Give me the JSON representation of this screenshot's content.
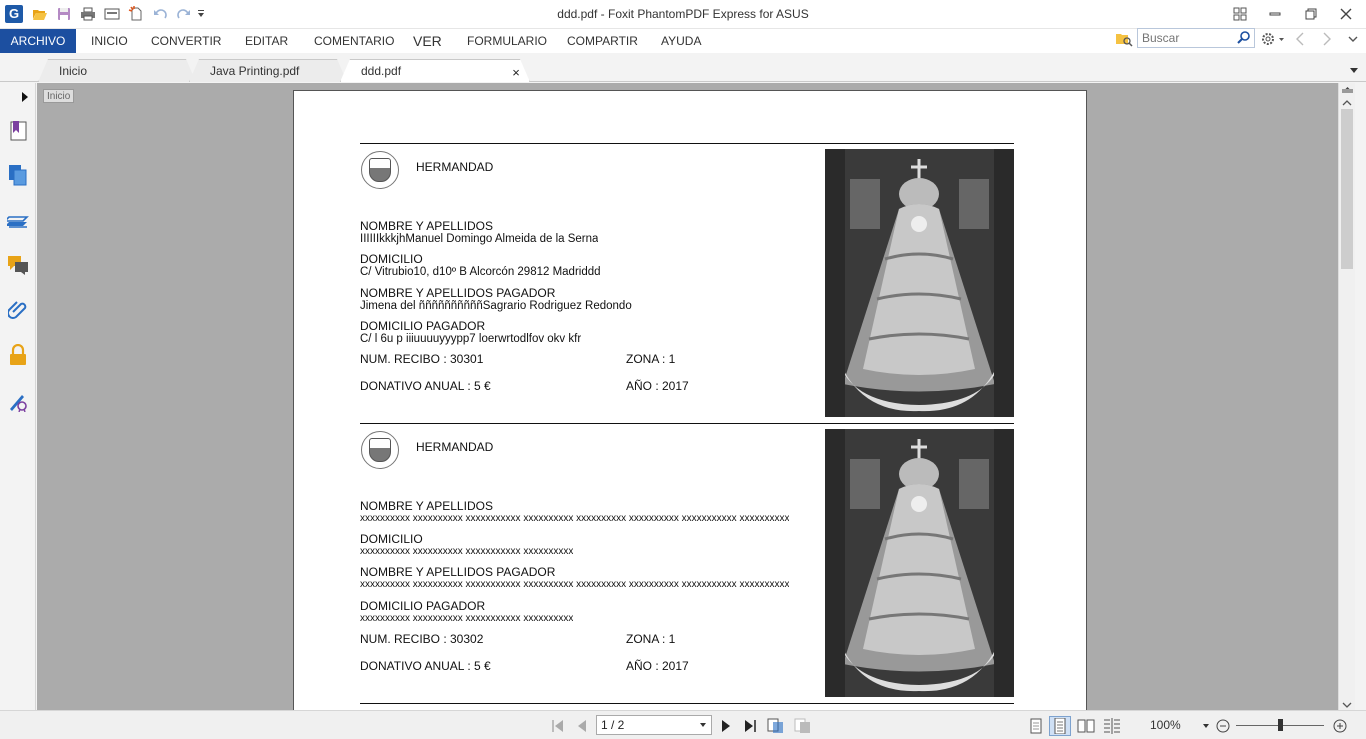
{
  "window": {
    "title": "ddd.pdf - Foxit PhantomPDF Express for ASUS",
    "logo_letter": "G"
  },
  "menu": {
    "items": [
      "ARCHIVO",
      "INICIO",
      "CONVERTIR",
      "EDITAR",
      "COMENTARIO",
      "VER",
      "FORMULARIO",
      "COMPARTIR",
      "AYUDA"
    ],
    "active": "ARCHIVO"
  },
  "search": {
    "placeholder": "Buscar"
  },
  "tabs": [
    {
      "label": "Inicio"
    },
    {
      "label": "Java Printing.pdf"
    },
    {
      "label": "ddd.pdf",
      "active": true
    }
  ],
  "tooltip": "Inicio",
  "receipts": [
    {
      "title": "HERMANDAD",
      "fields": [
        {
          "label": "NOMBRE Y APELLIDOS",
          "value": "IIIIIIkkkjhManuel Domingo Almeida de la Serna"
        },
        {
          "label": "DOMICILIO",
          "value": "C/ Vitrubio10, d10º B Alcorcón 29812 Madriddd"
        },
        {
          "label": "NOMBRE Y APELLIDOS PAGADOR",
          "value": "Jimena del ññññññññññSagrario Rodriguez Redondo"
        },
        {
          "label": "DOMICILIO PAGADOR",
          "value": "C/ l 6u p iiiuuuuyyypp7 loerwrtodlfov okv kfr"
        }
      ],
      "num_recibo": "NUM. RECIBO : 30301",
      "zona": "ZONA : 1",
      "donativo": "DONATIVO ANUAL : 5 €",
      "anio": "AÑO : 2017"
    },
    {
      "title": "HERMANDAD",
      "fields": [
        {
          "label": "NOMBRE Y APELLIDOS",
          "value": "xxxxxxxxxx xxxxxxxxxx xxxxxxxxxxx xxxxxxxxxx xxxxxxxxxx xxxxxxxxxx xxxxxxxxxxx xxxxxxxxxx"
        },
        {
          "label": "DOMICILIO",
          "value": "xxxxxxxxxx xxxxxxxxxx xxxxxxxxxxx xxxxxxxxxx"
        },
        {
          "label": "NOMBRE Y APELLIDOS PAGADOR",
          "value": "xxxxxxxxxx xxxxxxxxxx xxxxxxxxxxx xxxxxxxxxx xxxxxxxxxx xxxxxxxxxx xxxxxxxxxxx xxxxxxxxxx"
        },
        {
          "label": "DOMICILIO PAGADOR",
          "value": "xxxxxxxxxx xxxxxxxxxx xxxxxxxxxxx xxxxxxxxxx"
        }
      ],
      "num_recibo": "NUM. RECIBO : 30302",
      "zona": "ZONA : 1",
      "donativo": "DONATIVO ANUAL : 5 €",
      "anio": "AÑO : 2017"
    }
  ],
  "statusbar": {
    "page_indicator": "1 / 2",
    "zoom": "100%"
  },
  "colors": {
    "accent": "#1c4fa0",
    "doc_background": "#ababab",
    "nav_icon_blue": "#2a6fc4",
    "nav_icon_yellow": "#e8a317",
    "nav_icon_purple": "#7b3fa0"
  },
  "icons": {
    "quick_access": [
      "open-folder-icon",
      "save-icon",
      "print-icon",
      "scan-icon",
      "new-document-icon",
      "undo-icon",
      "redo-icon",
      "customize-dropdown-icon"
    ],
    "left_nav": [
      "bookmarks-icon",
      "pages-icon",
      "layers-icon",
      "comments-icon",
      "attachments-icon",
      "security-icon",
      "signatures-icon"
    ]
  }
}
